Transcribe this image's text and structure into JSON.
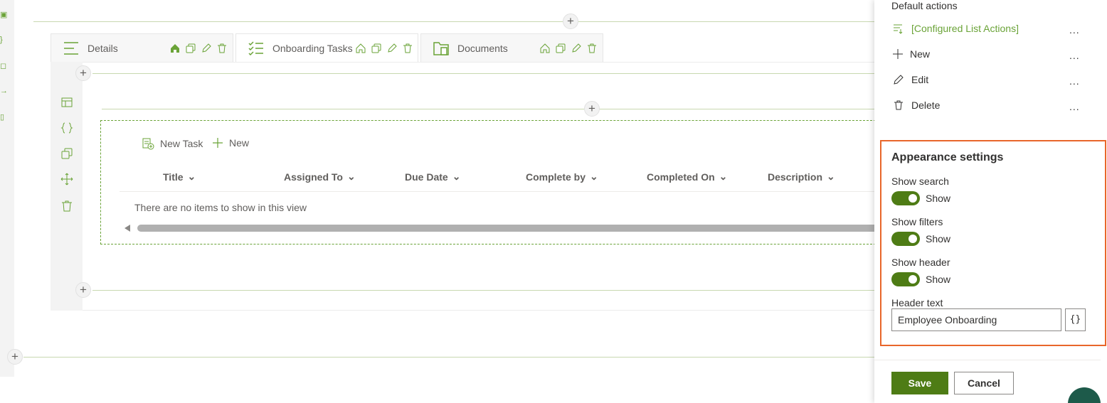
{
  "tabs": [
    {
      "label": "Details",
      "icon": "list-lines-icon"
    },
    {
      "label": "Onboarding Tasks",
      "icon": "checklist-icon"
    },
    {
      "label": "Documents",
      "icon": "folder-doc-icon"
    }
  ],
  "list": {
    "commands": {
      "new_task": "New Task",
      "new": "New"
    },
    "columns": [
      "Title",
      "Assigned To",
      "Due Date",
      "Complete by",
      "Completed On",
      "Description"
    ],
    "empty_message": "There are no items to show in this view"
  },
  "side_panel": {
    "default_actions_title": "Default actions",
    "actions": [
      {
        "label": "[Configured List Actions]",
        "icon": "configured-actions-icon",
        "more": "..."
      },
      {
        "label": "New",
        "icon": "plus-icon",
        "more": "..."
      },
      {
        "label": "Edit",
        "icon": "pencil-icon",
        "more": "..."
      },
      {
        "label": "Delete",
        "icon": "trash-icon",
        "more": "..."
      }
    ],
    "appearance": {
      "title": "Appearance settings",
      "show_search": {
        "label": "Show search",
        "toggle_text": "Show",
        "on": true
      },
      "show_filters": {
        "label": "Show filters",
        "toggle_text": "Show",
        "on": true
      },
      "show_header": {
        "label": "Show header",
        "toggle_text": "Show",
        "on": true
      },
      "header_text": {
        "label": "Header text",
        "value": "Employee Onboarding",
        "brace_label": "{}"
      }
    },
    "buttons": {
      "save": "Save",
      "cancel": "Cancel"
    }
  },
  "colors": {
    "accent": "#6aa337",
    "primary_button": "#4e7c15",
    "highlight_border": "#e8662a"
  }
}
